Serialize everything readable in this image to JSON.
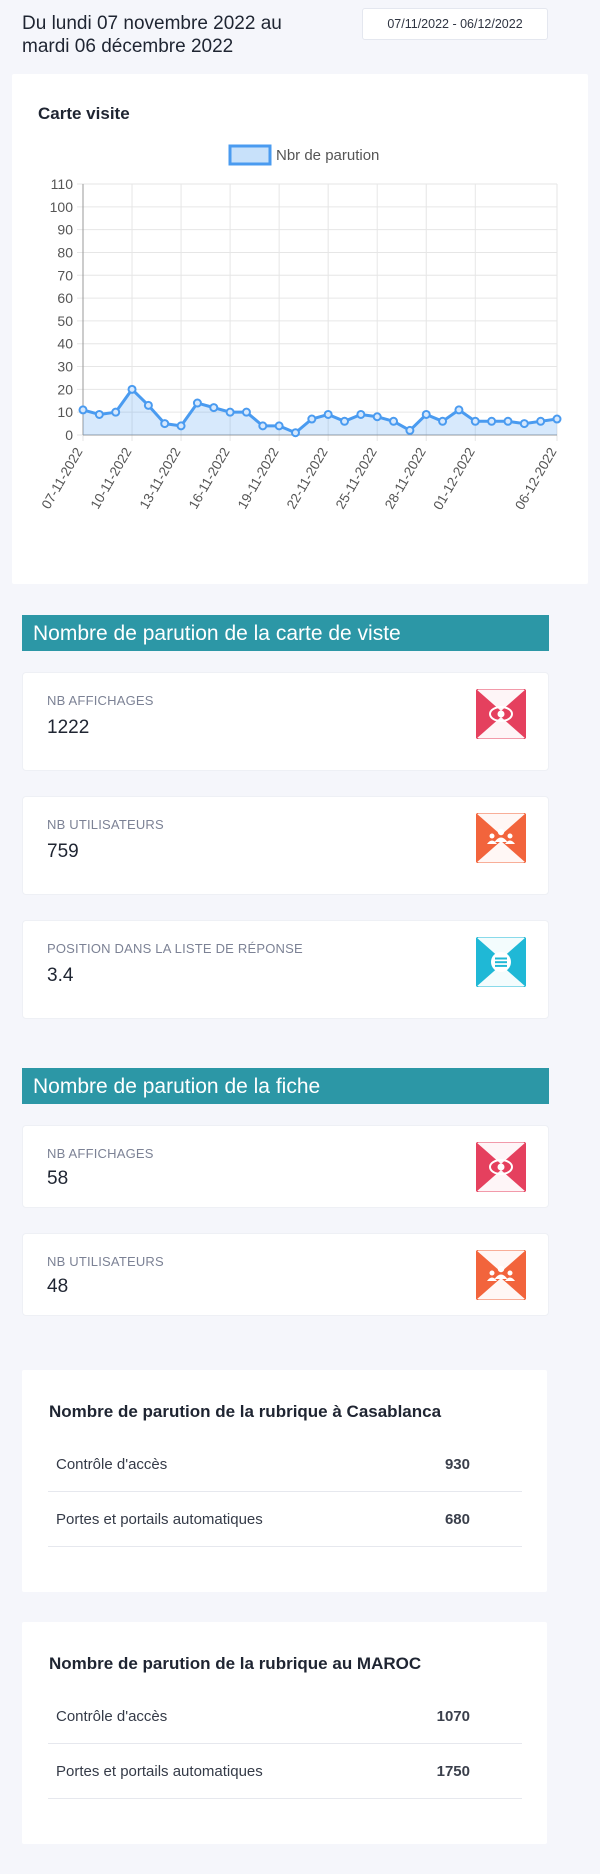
{
  "header": {
    "period_text": "Du lundi 07 novembre 2022 au mardi 06 décembre 2022",
    "date_range": "07/11/2022 - 06/12/2022"
  },
  "chart_card": {
    "title": "Carte visite"
  },
  "chart_data": {
    "type": "line",
    "title": "",
    "xlabel": "",
    "ylabel": "",
    "ylim": [
      0,
      110
    ],
    "yticks": [
      0,
      10,
      20,
      30,
      40,
      50,
      60,
      70,
      80,
      90,
      100,
      110
    ],
    "grid": true,
    "legend_position": "top",
    "fill": true,
    "x": [
      "07-11-2022",
      "08-11-2022",
      "09-11-2022",
      "10-11-2022",
      "11-11-2022",
      "12-11-2022",
      "13-11-2022",
      "14-11-2022",
      "15-11-2022",
      "16-11-2022",
      "17-11-2022",
      "18-11-2022",
      "19-11-2022",
      "20-11-2022",
      "21-11-2022",
      "22-11-2022",
      "23-11-2022",
      "24-11-2022",
      "25-11-2022",
      "26-11-2022",
      "27-11-2022",
      "28-11-2022",
      "29-11-2022",
      "30-11-2022",
      "01-12-2022",
      "02-12-2022",
      "03-12-2022",
      "04-12-2022",
      "05-12-2022",
      "06-12-2022"
    ],
    "x_tick_labels": [
      "07-11-2022",
      "10-11-2022",
      "13-11-2022",
      "16-11-2022",
      "19-11-2022",
      "22-11-2022",
      "25-11-2022",
      "28-11-2022",
      "01-12-2022",
      "06-12-2022"
    ],
    "series": [
      {
        "name": "Nbr de parution",
        "color": "#4a9bf0",
        "values": [
          11,
          9,
          10,
          20,
          13,
          5,
          4,
          14,
          12,
          10,
          10,
          4,
          4,
          1,
          7,
          9,
          6,
          9,
          8,
          6,
          2,
          9,
          6,
          11,
          6,
          6,
          6,
          5,
          6,
          7
        ]
      }
    ]
  },
  "section_carte": {
    "title": "Nombre de parution de la carte de viste",
    "stats": [
      {
        "label": "NB AFFICHAGES",
        "value": "1222",
        "icon": "eye-icon",
        "color": "#e5405e"
      },
      {
        "label": "NB UTILISATEURS",
        "value": "759",
        "icon": "users-icon",
        "color": "#f2643c"
      },
      {
        "label": "POSITION DANS LA LISTE DE RÉPONSE",
        "value": "3.4",
        "icon": "list-icon",
        "color": "#1fb8d6"
      }
    ]
  },
  "section_fiche": {
    "title": "Nombre de parution de la fiche",
    "stats": [
      {
        "label": "NB AFFICHAGES",
        "value": "58",
        "icon": "eye-icon",
        "color": "#e5405e"
      },
      {
        "label": "NB UTILISATEURS",
        "value": "48",
        "icon": "users-icon",
        "color": "#f2643c"
      }
    ]
  },
  "rubrique_casablanca": {
    "title": "Nombre de parution de la rubrique à Casablanca",
    "rows": [
      {
        "label": "Contrôle d'accès",
        "value": "930"
      },
      {
        "label": "Portes et portails automatiques",
        "value": "680"
      }
    ]
  },
  "rubrique_maroc": {
    "title": "Nombre de parution de la rubrique au MAROC",
    "rows": [
      {
        "label": "Contrôle d'accès",
        "value": "1070"
      },
      {
        "label": "Portes et portails automatiques",
        "value": "1750"
      }
    ]
  }
}
